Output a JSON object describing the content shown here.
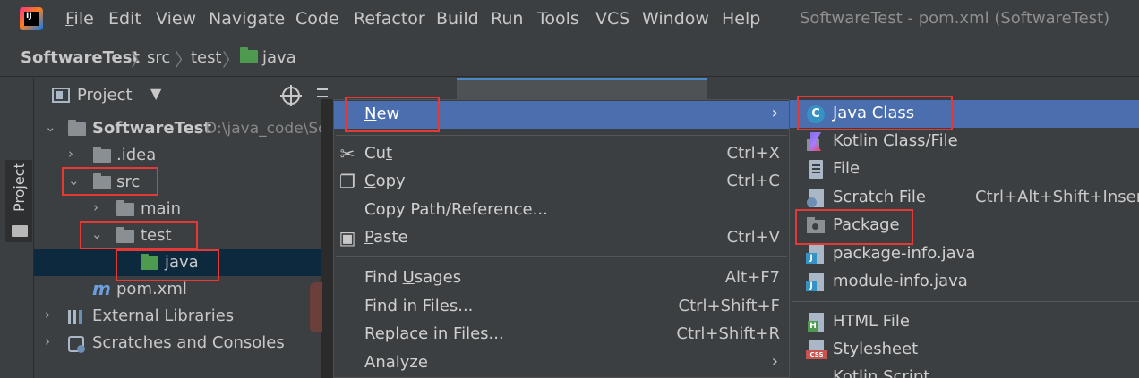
{
  "menubar": {
    "logo_text": "IJ",
    "items": [
      {
        "label": "File",
        "mnemonic": "F"
      },
      {
        "label": "Edit",
        "mnemonic": "E"
      },
      {
        "label": "View",
        "mnemonic": "V"
      },
      {
        "label": "Navigate",
        "mnemonic": "N"
      },
      {
        "label": "Code",
        "mnemonic": "C"
      },
      {
        "label": "Refactor",
        "mnemonic": "R"
      },
      {
        "label": "Build",
        "mnemonic": "B"
      },
      {
        "label": "Run",
        "mnemonic": "u"
      },
      {
        "label": "Tools",
        "mnemonic": "T"
      },
      {
        "label": "VCS",
        "mnemonic": "S"
      },
      {
        "label": "Window",
        "mnemonic": "W"
      },
      {
        "label": "Help",
        "mnemonic": "H"
      }
    ],
    "window_title": "SoftwareTest - pom.xml (SoftwareTest)"
  },
  "breadcrumb": {
    "project": "SoftwareTest",
    "items": [
      "src",
      "test",
      "java"
    ]
  },
  "tool_stripe": {
    "project_label": "Project"
  },
  "project_panel": {
    "title": "Project",
    "dropdown": "▼",
    "tree": {
      "project_name": "SoftwareTest",
      "project_path": "D:\\java_code\\So",
      "idea": ".idea",
      "src": "src",
      "main": "main",
      "test": "test",
      "java": "java",
      "pom": "pom.xml",
      "pom_icon": "m",
      "external_libraries": "External Libraries",
      "scratches": "Scratches and Consoles"
    }
  },
  "context_menu": {
    "new": {
      "pre": "",
      "mn": "N",
      "post": "ew"
    },
    "cut": {
      "pre": "Cu",
      "mn": "t",
      "post": "",
      "shortcut": "Ctrl+X"
    },
    "copy": {
      "pre": "",
      "mn": "C",
      "post": "opy",
      "shortcut": "Ctrl+C"
    },
    "copy_path": "Copy Path/Reference...",
    "paste": {
      "pre": "",
      "mn": "P",
      "post": "aste",
      "shortcut": "Ctrl+V"
    },
    "find_usages": {
      "pre": "Find ",
      "mn": "U",
      "post": "sages",
      "shortcut": "Alt+F7"
    },
    "find_in_files": {
      "label": "Find in Files...",
      "shortcut": "Ctrl+Shift+F"
    },
    "replace_in_files": {
      "pre": "Repl",
      "mn": "a",
      "post": "ce in Files...",
      "shortcut": "Ctrl+Shift+R"
    },
    "analyze": "Analyze",
    "submenu_arrow": "›",
    "icons": {
      "cut": "scissors-icon",
      "copy": "copy-icon",
      "paste": "clipboard-icon"
    }
  },
  "submenu": {
    "java_class": "Java Class",
    "java_class_icon": "C",
    "kotlin": "Kotlin Class/File",
    "file": "File",
    "scratch_file": {
      "label": "Scratch File",
      "shortcut": "Ctrl+Alt+Shift+Insert"
    },
    "package": "Package",
    "package_info": "package-info.java",
    "module_info": "module-info.java",
    "html_file": "HTML File",
    "stylesheet": "Stylesheet",
    "kotlin_script": "Kotlin Script"
  },
  "colors": {
    "selection": "#4b6eaf",
    "highlight_box": "#e53935",
    "tree_selection": "#0d293e"
  }
}
